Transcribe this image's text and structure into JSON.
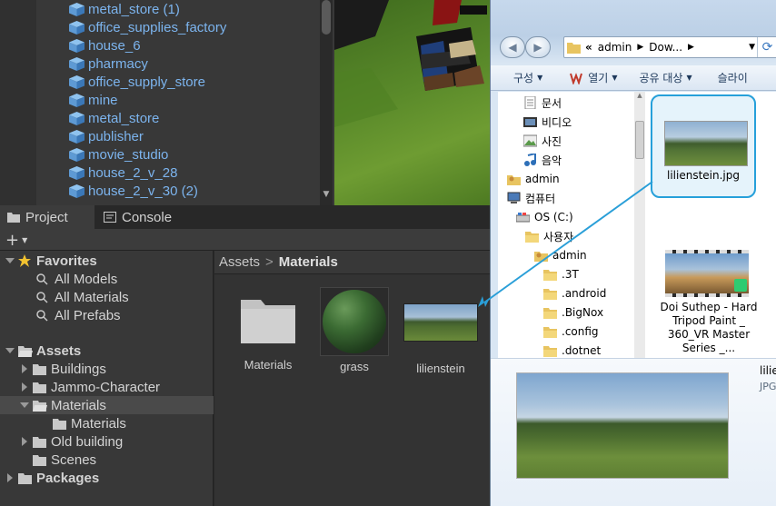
{
  "hierarchy": {
    "items": [
      {
        "label": "metal_store (1)"
      },
      {
        "label": "office_supplies_factory"
      },
      {
        "label": "house_6"
      },
      {
        "label": "pharmacy"
      },
      {
        "label": "office_supply_store"
      },
      {
        "label": "mine"
      },
      {
        "label": "metal_store"
      },
      {
        "label": "publisher"
      },
      {
        "label": "movie_studio"
      },
      {
        "label": "house_2_v_28"
      },
      {
        "label": "house_2_v_30 (2)"
      }
    ]
  },
  "tabs": {
    "project": "Project",
    "console": "Console"
  },
  "toolbar": {
    "add": "+"
  },
  "tree": {
    "favorites": "Favorites",
    "fav_items": [
      "All Models",
      "All Materials",
      "All Prefabs"
    ],
    "assets": "Assets",
    "asset_items": [
      "Buildings",
      "Jammo-Character",
      "Materials"
    ],
    "materials_child": "Materials",
    "asset_items_after": [
      "Old building",
      "Scenes"
    ],
    "packages": "Packages"
  },
  "breadcrumb": {
    "root": "Assets",
    "separator": ">",
    "current": "Materials"
  },
  "grid": {
    "items": [
      {
        "label": "Materials",
        "kind": "folder"
      },
      {
        "label": "grass",
        "kind": "material"
      },
      {
        "label": "lilienstein",
        "kind": "texture"
      }
    ]
  },
  "explorer": {
    "address": {
      "chevrons": "«",
      "parts": [
        "admin",
        "Dow..."
      ]
    },
    "commands": [
      {
        "label": "구성"
      },
      {
        "label": "열기"
      },
      {
        "label": "공유 대상"
      },
      {
        "label": "슬라이"
      }
    ],
    "nav": [
      {
        "label": "문서",
        "icon": "document-icon"
      },
      {
        "label": "비디오",
        "icon": "video-icon"
      },
      {
        "label": "사진",
        "icon": "picture-icon"
      },
      {
        "label": "음악",
        "icon": "music-icon"
      },
      {
        "label": "admin",
        "icon": "user-folder-icon"
      },
      {
        "label": "컴퓨터",
        "icon": "computer-icon"
      },
      {
        "label": "OS (C:)",
        "icon": "drive-icon"
      },
      {
        "label": "사용자",
        "icon": "folder-icon"
      },
      {
        "label": "admin",
        "icon": "user-folder-icon"
      },
      {
        "label": ".3T",
        "icon": "folder-icon"
      },
      {
        "label": ".android",
        "icon": "folder-icon"
      },
      {
        "label": ".BigNox",
        "icon": "folder-icon"
      },
      {
        "label": ".config",
        "icon": "folder-icon"
      },
      {
        "label": ".dotnet",
        "icon": "folder-icon"
      }
    ],
    "files": [
      {
        "label": "lilienstein.jpg",
        "selected": true
      },
      {
        "label": "Doi Suthep - Hard Tripod Paint _ 360_VR Master Series _..."
      }
    ],
    "preview": {
      "name": "lilie",
      "type": "JPG"
    }
  },
  "colors": {
    "unity_bg": "#383838",
    "hierarchy_text": "#7cb4ee",
    "drag_line": "#2a9fd8",
    "selection_border": "#26a0da"
  }
}
